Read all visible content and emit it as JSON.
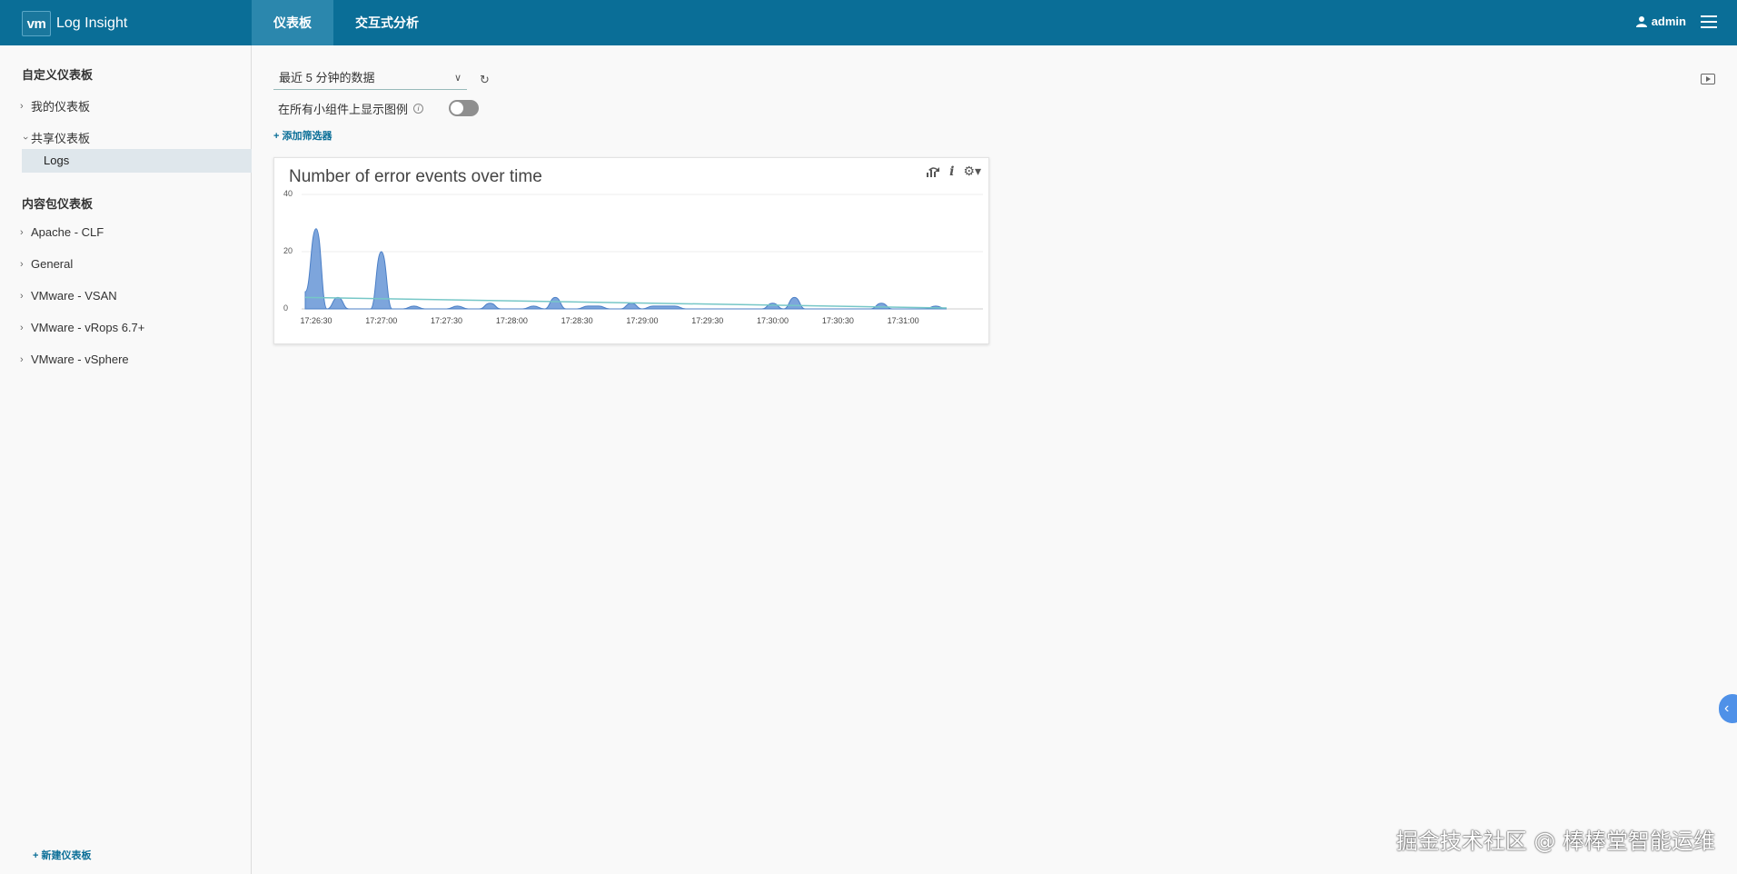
{
  "header": {
    "logo_text": "vm",
    "app_name": "Log Insight",
    "tabs": [
      {
        "label": "仪表板",
        "active": true
      },
      {
        "label": "交互式分析",
        "active": false
      }
    ],
    "user": "admin"
  },
  "sidebar": {
    "custom_title": "自定义仪表板",
    "custom_items": [
      {
        "label": "我的仪表板",
        "expanded": false
      },
      {
        "label": "共享仪表板",
        "expanded": true
      }
    ],
    "shared_children": [
      "Logs"
    ],
    "content_title": "内容包仪表板",
    "content_items": [
      "Apache - CLF",
      "General",
      "VMware - VSAN",
      "VMware - vRops 6.7+",
      "VMware - vSphere"
    ],
    "new_dashboard": "+ 新建仪表板"
  },
  "main": {
    "time_range": "最近 5 分钟的数据",
    "legend_label": "在所有小组件上显示图例",
    "legend_toggle_on": false,
    "add_filter": "+ 添加筛选器"
  },
  "widget": {
    "title": "Number of error events over time"
  },
  "chart_data": {
    "type": "area",
    "title": "Number of error events over time",
    "ylim": [
      0,
      40
    ],
    "yticks": [
      0,
      20,
      40
    ],
    "x_tick_labels": [
      "17:26:30",
      "17:27:00",
      "17:27:30",
      "17:28:00",
      "17:28:30",
      "17:29:00",
      "17:29:30",
      "17:30:00",
      "17:30:30",
      "17:31:00"
    ],
    "x_seconds": [
      0,
      5,
      10,
      15,
      20,
      25,
      30,
      35,
      40,
      45,
      50,
      55,
      60,
      65,
      70,
      75,
      80,
      85,
      90,
      95,
      100,
      105,
      110,
      115,
      120,
      125,
      130,
      135,
      140,
      145,
      150,
      155,
      160,
      165,
      170,
      175,
      180,
      185,
      190,
      195,
      200,
      205,
      210,
      215,
      220,
      225,
      230,
      235,
      240,
      245,
      250,
      255,
      260,
      265,
      270,
      275,
      280,
      285,
      290,
      295
    ],
    "series": [
      {
        "values": [
          6,
          28,
          0,
          4,
          0,
          0,
          0,
          20,
          0,
          0,
          1,
          0,
          0,
          0,
          1,
          0,
          0,
          2,
          0,
          0,
          0,
          1,
          0,
          4,
          0,
          0,
          1,
          1,
          0,
          0,
          2,
          0,
          1,
          1,
          1,
          0,
          0,
          0,
          0,
          0,
          0,
          0,
          0,
          2,
          0,
          4,
          0,
          0,
          0,
          0,
          0,
          0,
          0,
          2,
          0,
          0,
          0,
          0,
          1,
          0
        ]
      },
      {
        "trend": true,
        "values": [
          4,
          0.3
        ]
      }
    ],
    "grid": true,
    "colors": {
      "area": "#6f9bd8",
      "area_stroke": "#4b7fc6",
      "trend": "#76c7c7"
    }
  },
  "watermark": "掘金技术社区 @ 棒棒堂智能运维"
}
